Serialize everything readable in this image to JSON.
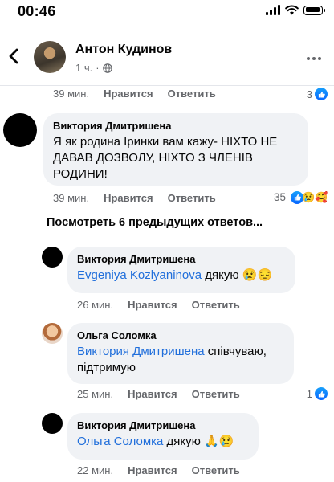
{
  "status_bar": {
    "time": "00:46"
  },
  "header": {
    "name": "Антон Кудинов",
    "time": "1 ч."
  },
  "top_meta": {
    "time": "39 мин.",
    "like": "Нравится",
    "reply": "Ответить",
    "count": "3"
  },
  "comment_main": {
    "author": "Виктория Дмитришена",
    "text": "Я як родина Іринки вам кажу-  НІХТО НЕ ДАВАВ ДОЗВОЛУ, НІХТО З ЧЛЕНІВ РОДИНИ!",
    "time": "39 мин.",
    "like": "Нравится",
    "reply": "Ответить",
    "count": "35"
  },
  "view_previous": "Посмотреть 6 предыдущих ответов...",
  "replies": [
    {
      "author": "Виктория Дмитришена",
      "mention": "Evgeniya Kozlyaninova",
      "text": "дякую",
      "emoji": "😢😔",
      "time": "26 мин.",
      "like": "Нравится",
      "reply": "Ответить"
    },
    {
      "author": "Ольга Соломка",
      "mention": "Виктория Дмитришена",
      "text": "співчуваю, підтримую",
      "time": "25 мин.",
      "like": "Нравится",
      "reply": "Ответить",
      "count": "1"
    },
    {
      "author": "Виктория Дмитришена",
      "mention": "Ольга Соломка",
      "text": "дякую",
      "emoji": "🙏😢",
      "time": "22 мин.",
      "like": "Нравится",
      "reply": "Ответить"
    }
  ],
  "colors": {
    "mention": "#216fdb",
    "like_blue": "#0866ff",
    "bubble": "#f0f2f5",
    "meta": "#65676b"
  },
  "icons": {
    "back": "chevron-left-icon",
    "more": "more-dots-icon",
    "globe": "globe-icon",
    "like": "thumbs-up-icon"
  }
}
